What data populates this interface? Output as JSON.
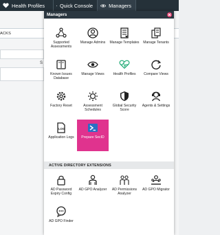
{
  "topbar": {
    "items": [
      {
        "label": "Health Profiles",
        "icon": "heart-icon"
      },
      {
        "label": "Quick Console",
        "icon": "grid-icon"
      },
      {
        "label": "Managers",
        "icon": "eye-icon"
      }
    ]
  },
  "background": {
    "section_title": "ACKS",
    "fragment_letter": "S"
  },
  "panel": {
    "title": "Managers",
    "tiles": [
      {
        "label": "Supported Assessments",
        "icon": "nodes-icon"
      },
      {
        "label": "Manage Admins",
        "icon": "user-icon"
      },
      {
        "label": "Manage Templates",
        "icon": "template-icon"
      },
      {
        "label": "Manage Tenants",
        "icon": "tenants-icon"
      },
      {
        "label": "Known Issues Database",
        "icon": "book-icon"
      },
      {
        "label": "Manage Views",
        "icon": "eye-icon"
      },
      {
        "label": "Health Profiles",
        "icon": "heartbeat-icon"
      },
      {
        "label": "Compare Views",
        "icon": "compare-icon"
      },
      {
        "label": "Factory Reset",
        "icon": "gear-icon"
      },
      {
        "label": "Assessment Schedules",
        "icon": "schedule-icon"
      },
      {
        "label": "Global Security Score",
        "icon": "shield-icon"
      },
      {
        "label": "Agents & Settings",
        "icon": "agent-icon"
      },
      {
        "label": "Application Logs",
        "icon": "logs-icon"
      },
      {
        "label": "Prepare SecID",
        "icon": "powershell-icon"
      }
    ],
    "section_title": "ACTIVE DIRECTORY EXTENSIONS",
    "ad_tiles": [
      {
        "label": "AD Password Expiry Config",
        "icon": "lock-icon"
      },
      {
        "label": "AD GPO Analyzer",
        "icon": "person-icon"
      },
      {
        "label": "AD Permissions Analyzer",
        "icon": "people-icon"
      },
      {
        "label": "AD GPO Migrator",
        "icon": "users-icon"
      },
      {
        "label": "AD GPO Finder",
        "icon": "chat-icon"
      }
    ],
    "highlight_color": "#e0338e"
  }
}
